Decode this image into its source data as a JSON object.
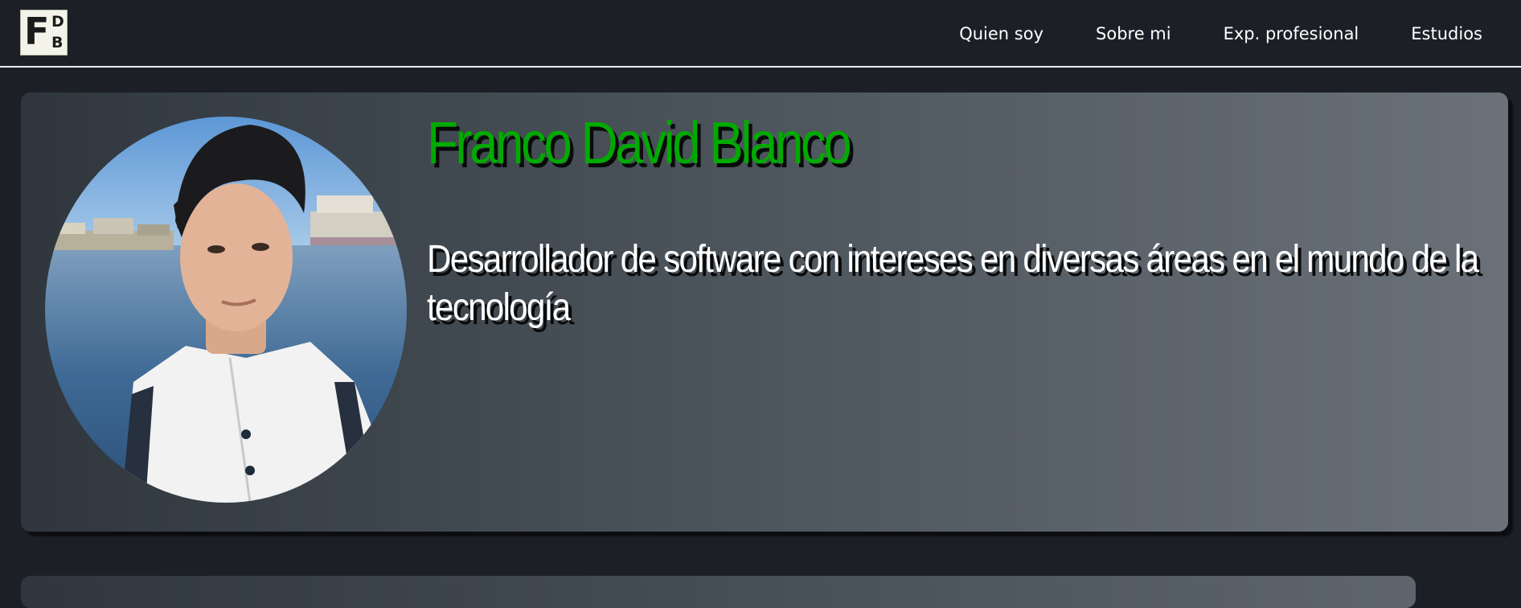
{
  "header": {
    "logo": {
      "letters": [
        "F",
        "D",
        "B"
      ]
    },
    "nav": [
      {
        "label": "Quien soy"
      },
      {
        "label": "Sobre mi"
      },
      {
        "label": "Exp. profesional"
      },
      {
        "label": "Estudios"
      }
    ]
  },
  "hero": {
    "name": "Franco David Blanco",
    "tagline": "Desarrollador de software con intereses en diversas áreas en el mundo de la tecnología"
  },
  "colors": {
    "background": "#1c2026",
    "accent_green": "#00aa00",
    "text": "#ffffff"
  },
  "icons": [
    "fdb-logo",
    "profile-photo"
  ]
}
